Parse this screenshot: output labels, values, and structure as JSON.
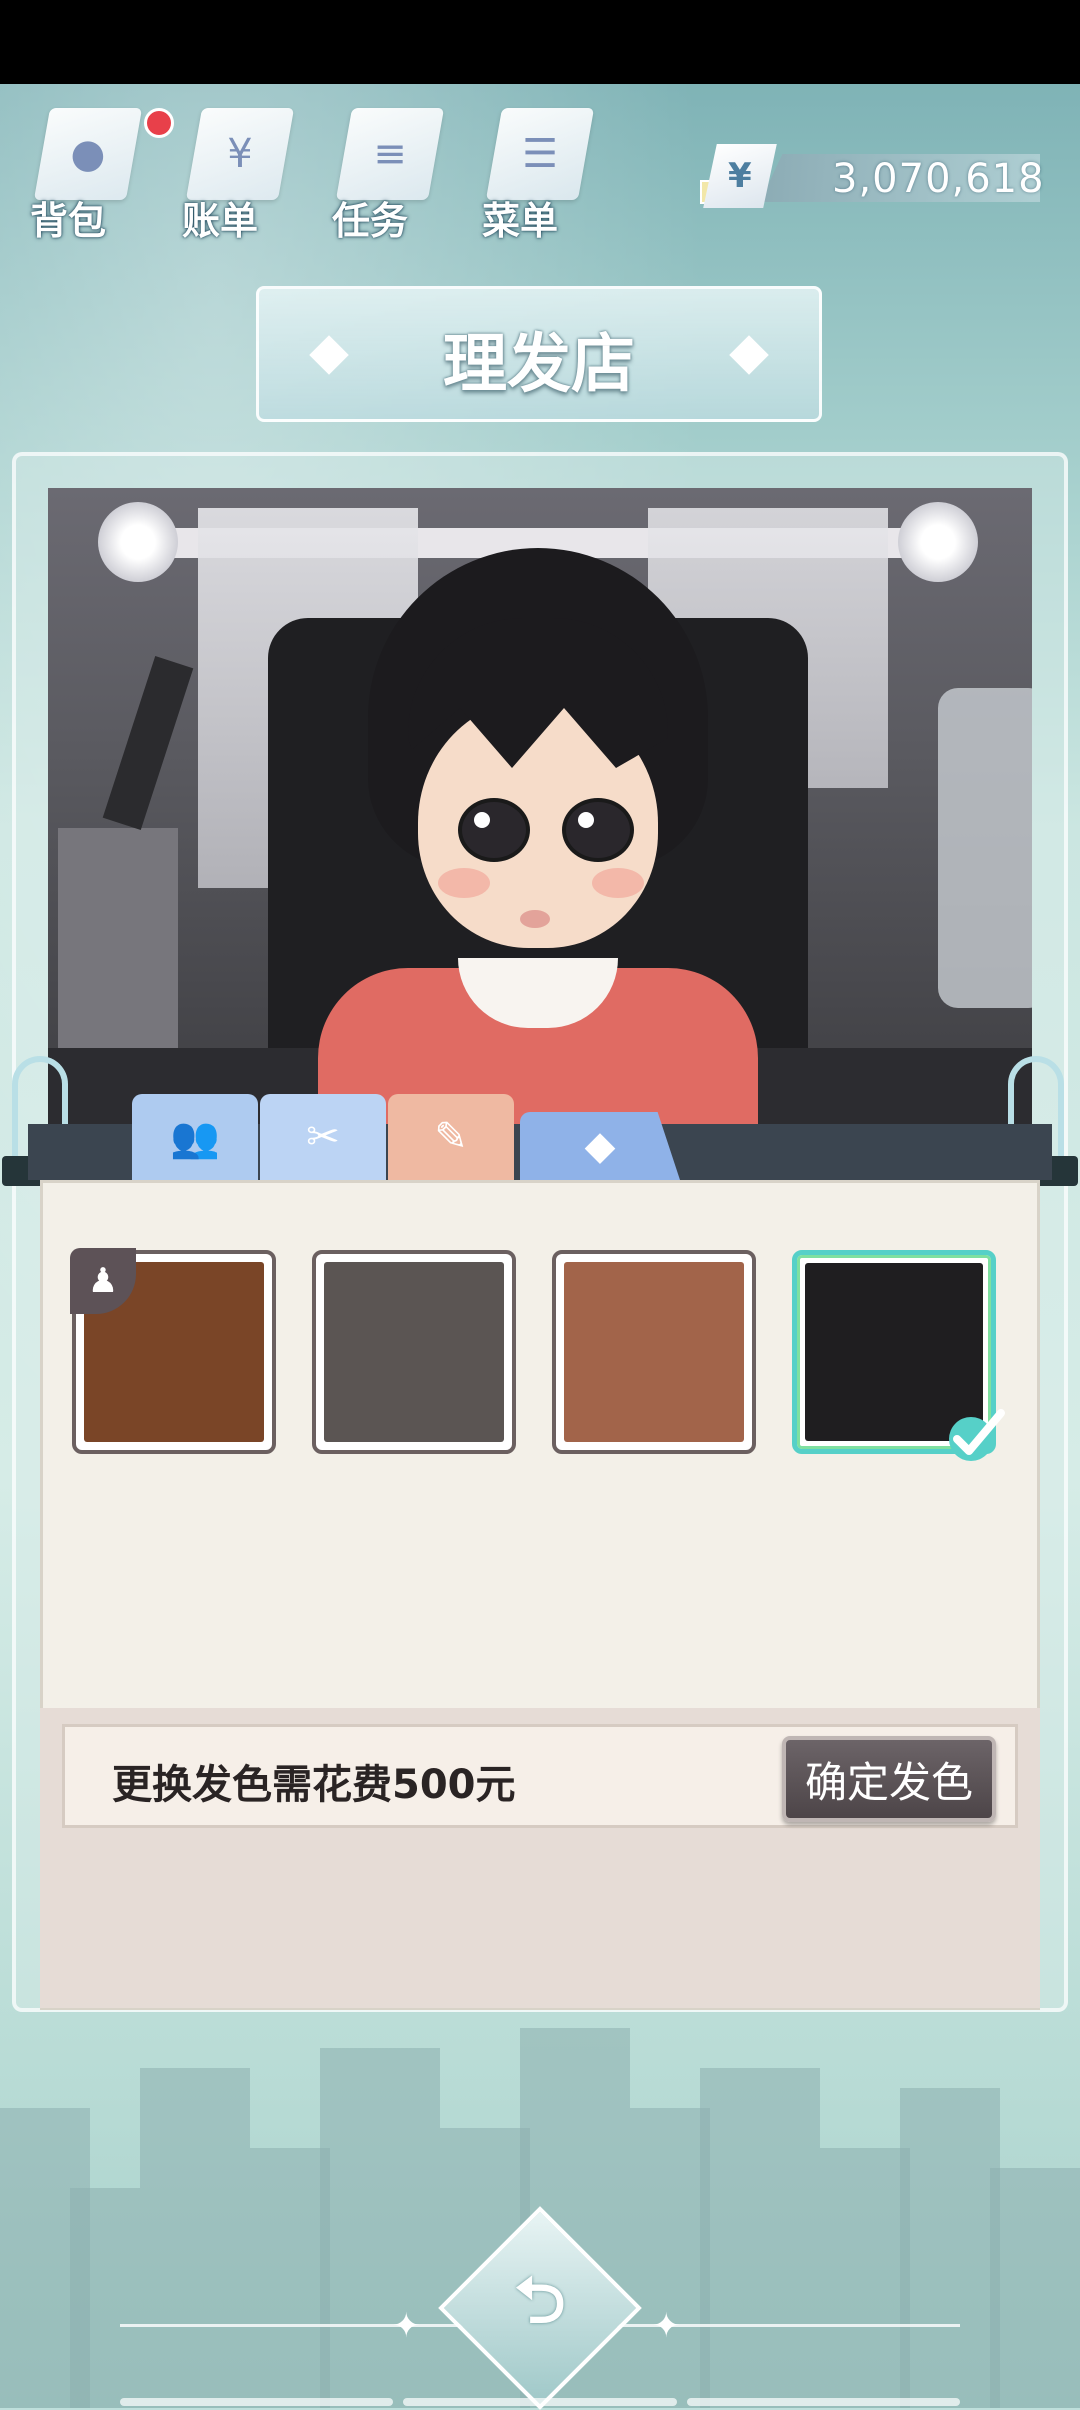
{
  "topnav": {
    "items": [
      {
        "label": "背包",
        "icon": "bag-icon",
        "glyph": "●",
        "badge": true
      },
      {
        "label": "账单",
        "icon": "bill-icon",
        "glyph": "¥",
        "badge": false
      },
      {
        "label": "任务",
        "icon": "task-icon",
        "glyph": "≡",
        "badge": false
      },
      {
        "label": "菜单",
        "icon": "menu-icon",
        "glyph": "☰",
        "badge": false
      }
    ]
  },
  "currency": {
    "symbol": "¥",
    "value": "3,070,618"
  },
  "page": {
    "title": "理发店"
  },
  "tabs": [
    {
      "name": "tab-people",
      "glyph": "👥"
    },
    {
      "name": "tab-haircut",
      "glyph": "✂"
    },
    {
      "name": "tab-hair-dye",
      "glyph": "✎"
    },
    {
      "name": "tab-accessories",
      "glyph": "◆"
    }
  ],
  "colors": {
    "swatches": [
      "#7a4527",
      "#5b5553",
      "#a2644a",
      "#1f1e20"
    ],
    "selected_index": 3,
    "current_index": 0
  },
  "footer": {
    "info": "更换发色需花费500元",
    "confirm_label": "确定发色"
  },
  "back": {
    "glyph": "⮌"
  }
}
